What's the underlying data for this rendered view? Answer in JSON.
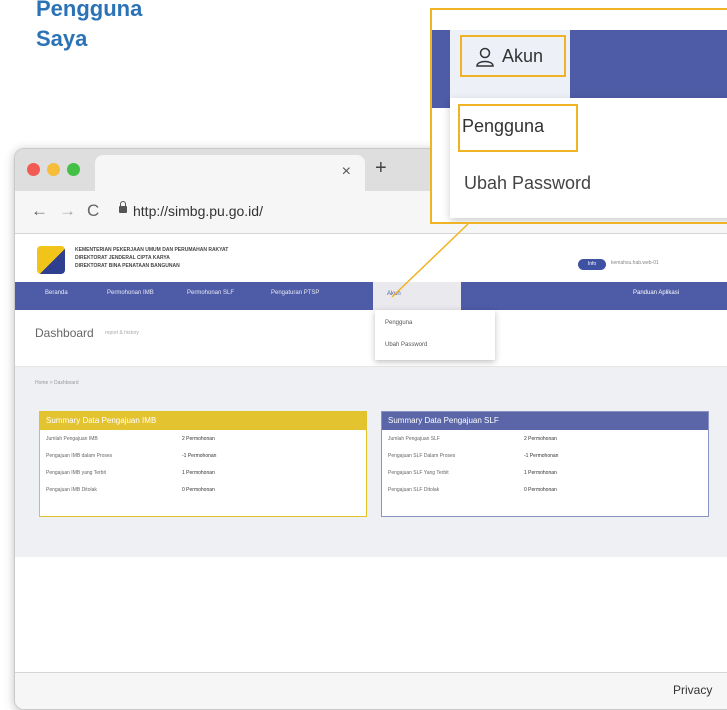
{
  "heading": {
    "line1": "Pengguna",
    "line2": "Saya"
  },
  "browser": {
    "tab_close": "×",
    "new_tab": "+",
    "back": "←",
    "forward": "→",
    "reload": "C",
    "url": "http://simbg.pu.go.id/"
  },
  "site": {
    "ministry_line1": "KEMENTERIAN PEKERJAAN UMUM DAN PERUMAHAN RAKYAT",
    "ministry_line2": "DIREKTORAT JENDERAL CIPTA KARYA",
    "ministry_line3": "DIREKTORAT BINA PENATAAN BANGUNAN",
    "user_badge": "Info",
    "user_name": "kemahsu.hab.web-01",
    "nav": {
      "beranda": "Beranda",
      "imb": "Permohonan IMB",
      "slf": "Permohonan SLF",
      "pengaturan": "Pengaturan PTSP",
      "akun": "Akun",
      "panduan": "Panduan Aplikasi"
    },
    "dashboard": {
      "title": "Dashboard",
      "subtitle": "report & history"
    },
    "breadcrumb": "Home > Dashboard",
    "dropdown_small": {
      "pengguna": "Pengguna",
      "ubah": "Ubah Password"
    }
  },
  "cards": [
    {
      "title": "Summary Data Pengajuan IMB",
      "rows": [
        {
          "label": "Jumlah Pengajuan IMB",
          "value": "2 Permohonan"
        },
        {
          "label": "Pengajuan IMB dalam Proses",
          "value": "-1 Permohonan"
        },
        {
          "label": "Pengajuan IMB yang Terbit",
          "value": "1 Permohonan"
        },
        {
          "label": "Pengajuan IMB Ditolak",
          "value": "0 Permohonan"
        }
      ]
    },
    {
      "title": "Summary Data Pengajuan SLF",
      "rows": [
        {
          "label": "Jumlah Pengajuan SLF",
          "value": "2 Permohonan"
        },
        {
          "label": "Pengajuan SLF Dalam Proses",
          "value": "-1 Permohonan"
        },
        {
          "label": "Pengajuan SLF Yang Terbit",
          "value": "1 Permohonan"
        },
        {
          "label": "Pengajuan SLF Ditolak",
          "value": "0 Permohonan"
        }
      ]
    }
  ],
  "status": {
    "privacy": "Privacy",
    "trail": "T"
  },
  "zoom": {
    "akun": "Akun",
    "pengguna": "Pengguna",
    "ubah": "Ubah Password"
  },
  "colors": {
    "accent_yellow": "#f0b323",
    "nav_blue": "#4e5ba6",
    "heading_blue": "#2b73b6"
  }
}
